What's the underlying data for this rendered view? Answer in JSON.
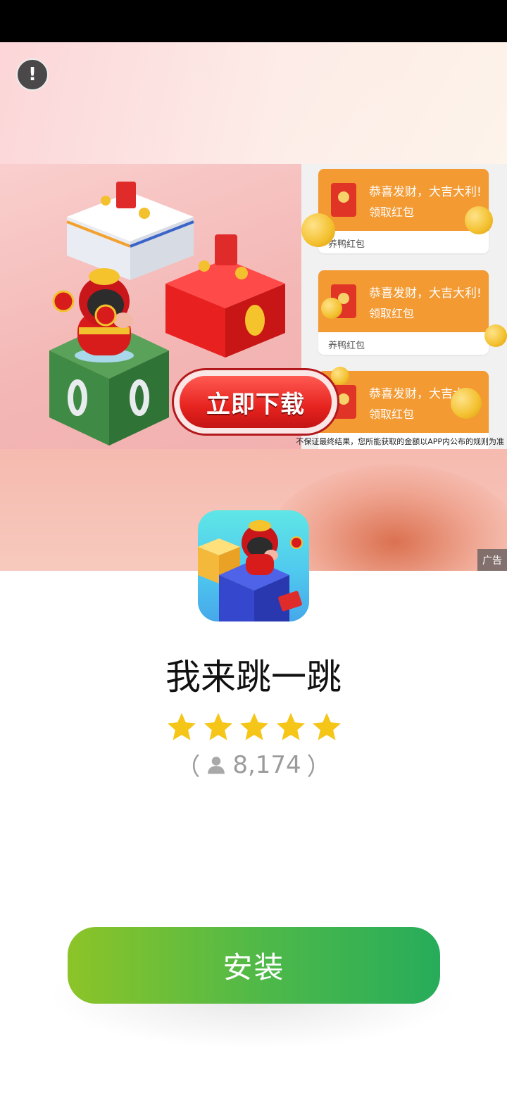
{
  "ad": {
    "info_icon": "exclamation-icon",
    "info_glyph": "!",
    "badge_label": "广告",
    "banner": {
      "download_button_label": "立即下载",
      "disclaimer": "不保证最终结果，您所能获取的金额以APP内公布的规则为准",
      "cards": [
        {
          "title": "恭喜发财，大吉大利!",
          "subtitle": "领取红包",
          "footer": "养鸭红包"
        },
        {
          "title": "恭喜发财，大吉大利!",
          "subtitle": "领取红包",
          "footer": "养鸭红包"
        },
        {
          "title": "恭喜发财，大吉大",
          "subtitle": "领取红包",
          "footer": ""
        }
      ]
    }
  },
  "app": {
    "name": "我来跳一跳",
    "rating_stars": 5,
    "rating_count_open": "（",
    "rating_count": "8,174",
    "rating_count_close": "）",
    "user_icon": "person-icon"
  },
  "install": {
    "label": "安装"
  },
  "colors": {
    "install_start": "#8cc428",
    "install_end": "#27ac5a",
    "star": "#f5c518",
    "card_orange": "#f39a33",
    "cta_red": "#e6231f"
  }
}
